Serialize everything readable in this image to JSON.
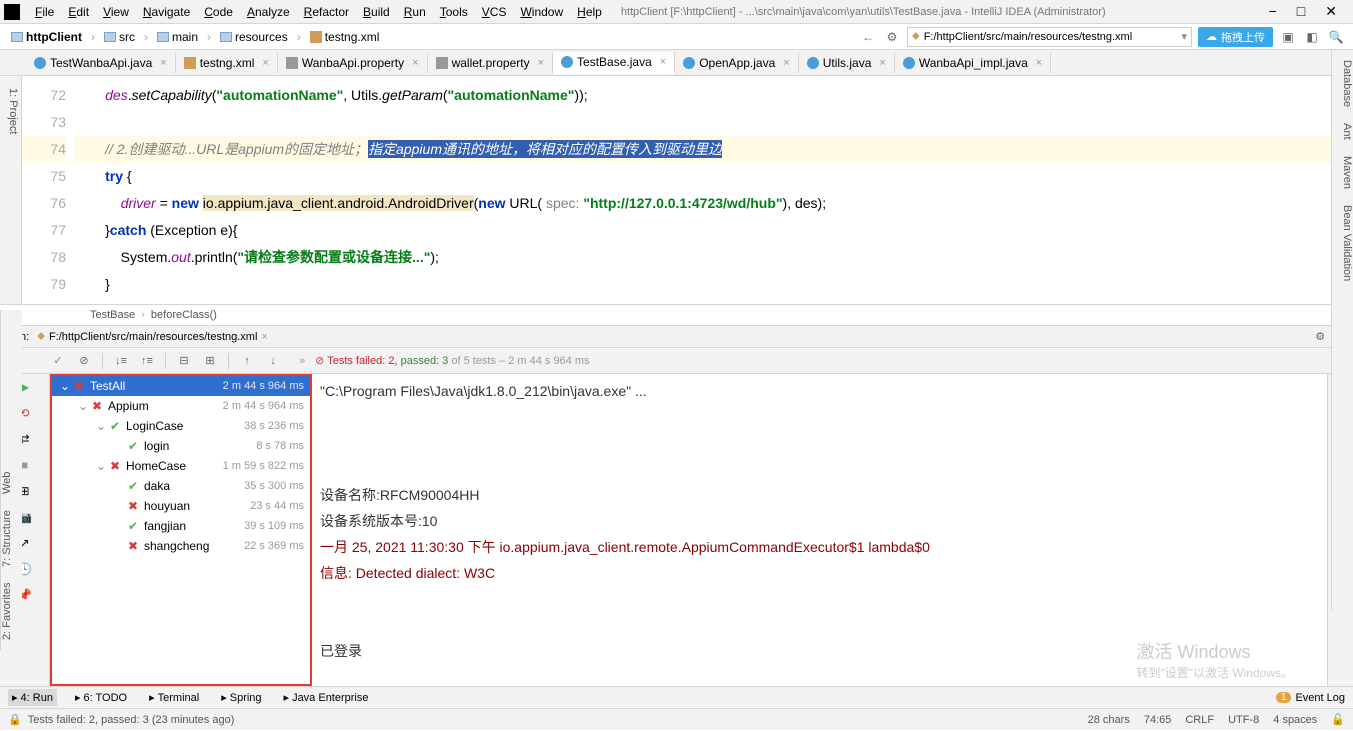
{
  "window": {
    "title": "httpClient [F:\\httpClient] - ...\\src\\main\\java\\com\\yan\\utils\\TestBase.java - IntelliJ IDEA (Administrator)"
  },
  "menu": [
    "File",
    "Edit",
    "View",
    "Navigate",
    "Code",
    "Analyze",
    "Refactor",
    "Build",
    "Run",
    "Tools",
    "VCS",
    "Window",
    "Help"
  ],
  "breadcrumb": {
    "items": [
      "httpClient",
      "src",
      "main",
      "resources",
      "testng.xml"
    ]
  },
  "path_dropdown": "F:/httpClient/src/main/resources/testng.xml",
  "upload_label": "拖拽上传",
  "tabs": [
    {
      "name": "TestWanbaApi.java",
      "type": "java",
      "active": false
    },
    {
      "name": "testng.xml",
      "type": "xml",
      "active": false
    },
    {
      "name": "WanbaApi.property",
      "type": "prop",
      "active": false
    },
    {
      "name": "wallet.property",
      "type": "prop",
      "active": false
    },
    {
      "name": "TestBase.java",
      "type": "java",
      "active": true
    },
    {
      "name": "OpenApp.java",
      "type": "java",
      "active": false
    },
    {
      "name": "Utils.java",
      "type": "java",
      "active": false
    },
    {
      "name": "WanbaApi_impl.java",
      "type": "java",
      "active": false
    }
  ],
  "editor": {
    "lines": [
      {
        "n": 72,
        "text": "        des.setCapability(\"automationName\", Utils.getParam(\"automationName\"));",
        "comment": false
      },
      {
        "n": 73,
        "text": "",
        "comment": false
      },
      {
        "n": 74,
        "text": "        // 2.创建驱动...URL是appium的固定地址；",
        "sel": "指定appium通讯的地址，将相对应的配置传入到驱动里边",
        "hl": true
      },
      {
        "n": 75,
        "text": "        try {",
        "comment": false
      },
      {
        "n": 76,
        "text": "            driver = new io.appium.java_client.android.AndroidDriver(new URL( spec: \"http://127.0.0.1:4723/wd/hub\"), des);",
        "comment": false
      },
      {
        "n": 77,
        "text": "        }catch (Exception e){",
        "comment": false
      },
      {
        "n": 78,
        "text": "            System.out.println(\"请检查参数配置或设备连接...\");",
        "comment": false
      },
      {
        "n": 79,
        "text": "        }",
        "comment": false
      }
    ],
    "crumb": [
      "TestBase",
      "beforeClass()"
    ]
  },
  "run": {
    "label": "Run:",
    "config": "F:/httpClient/src/main/resources/testng.xml",
    "status_prefix": "Tests failed: 2,",
    "status_pass": " passed: 3",
    "status_suffix": " of 5 tests – 2 m 44 s 964 ms",
    "tree": [
      {
        "depth": 0,
        "icon": "fail",
        "name": "TestAll",
        "time": "2 m 44 s 964 ms",
        "exp": "v",
        "selected": true
      },
      {
        "depth": 1,
        "icon": "fail",
        "name": "Appium",
        "time": "2 m 44 s 964 ms",
        "exp": "v"
      },
      {
        "depth": 2,
        "icon": "pass",
        "name": "LoginCase",
        "time": "38 s 236 ms",
        "exp": "v"
      },
      {
        "depth": 3,
        "icon": "pass",
        "name": "login",
        "time": "8 s 78 ms",
        "exp": ""
      },
      {
        "depth": 2,
        "icon": "fail",
        "name": "HomeCase",
        "time": "1 m 59 s 822 ms",
        "exp": "v"
      },
      {
        "depth": 3,
        "icon": "pass",
        "name": "daka",
        "time": "35 s 300 ms",
        "exp": ""
      },
      {
        "depth": 3,
        "icon": "fail",
        "name": "houyuan",
        "time": "23 s 44 ms",
        "exp": ""
      },
      {
        "depth": 3,
        "icon": "pass",
        "name": "fangjian",
        "time": "39 s 109 ms",
        "exp": ""
      },
      {
        "depth": 3,
        "icon": "fail",
        "name": "shangcheng",
        "time": "22 s 369 ms",
        "exp": ""
      }
    ],
    "console": [
      {
        "text": "\"C:\\Program Files\\Java\\jdk1.8.0_212\\bin\\java.exe\" ...",
        "cls": ""
      },
      {
        "text": "",
        "cls": ""
      },
      {
        "text": "",
        "cls": ""
      },
      {
        "text": "",
        "cls": ""
      },
      {
        "text": "设备名称:RFCM90004HH",
        "cls": ""
      },
      {
        "text": "设备系统版本号:10",
        "cls": ""
      },
      {
        "text": "一月 25, 2021 11:30:30 下午 io.appium.java_client.remote.AppiumCommandExecutor$1 lambda$0",
        "cls": "dark-red"
      },
      {
        "text": "信息: Detected dialect: W3C",
        "cls": "dark-red"
      },
      {
        "text": "",
        "cls": ""
      },
      {
        "text": "",
        "cls": ""
      },
      {
        "text": "已登录",
        "cls": ""
      }
    ]
  },
  "bottom_tabs": [
    {
      "label": "4: Run",
      "active": true
    },
    {
      "label": "6: TODO"
    },
    {
      "label": "Terminal"
    },
    {
      "label": "Spring"
    },
    {
      "label": "Java Enterprise"
    }
  ],
  "event_log": {
    "badge": "1",
    "label": "Event Log"
  },
  "statusbar": {
    "left": "Tests failed: 2, passed: 3 (23 minutes ago)",
    "chars": "28 chars",
    "pos": "74:65",
    "eol": "CRLF",
    "enc": "UTF-8",
    "indent": "4 spaces"
  },
  "left_sidebar": [
    "1: Project"
  ],
  "left_sidebar2": [
    "2: Favorites",
    "7: Structure",
    "Web"
  ],
  "right_sidebar": [
    "Database",
    "Ant",
    "Maven",
    "Bean Validation"
  ],
  "watermark": {
    "main": "激活 Windows",
    "sub": "转到\"设置\"以激活 Windows。"
  }
}
